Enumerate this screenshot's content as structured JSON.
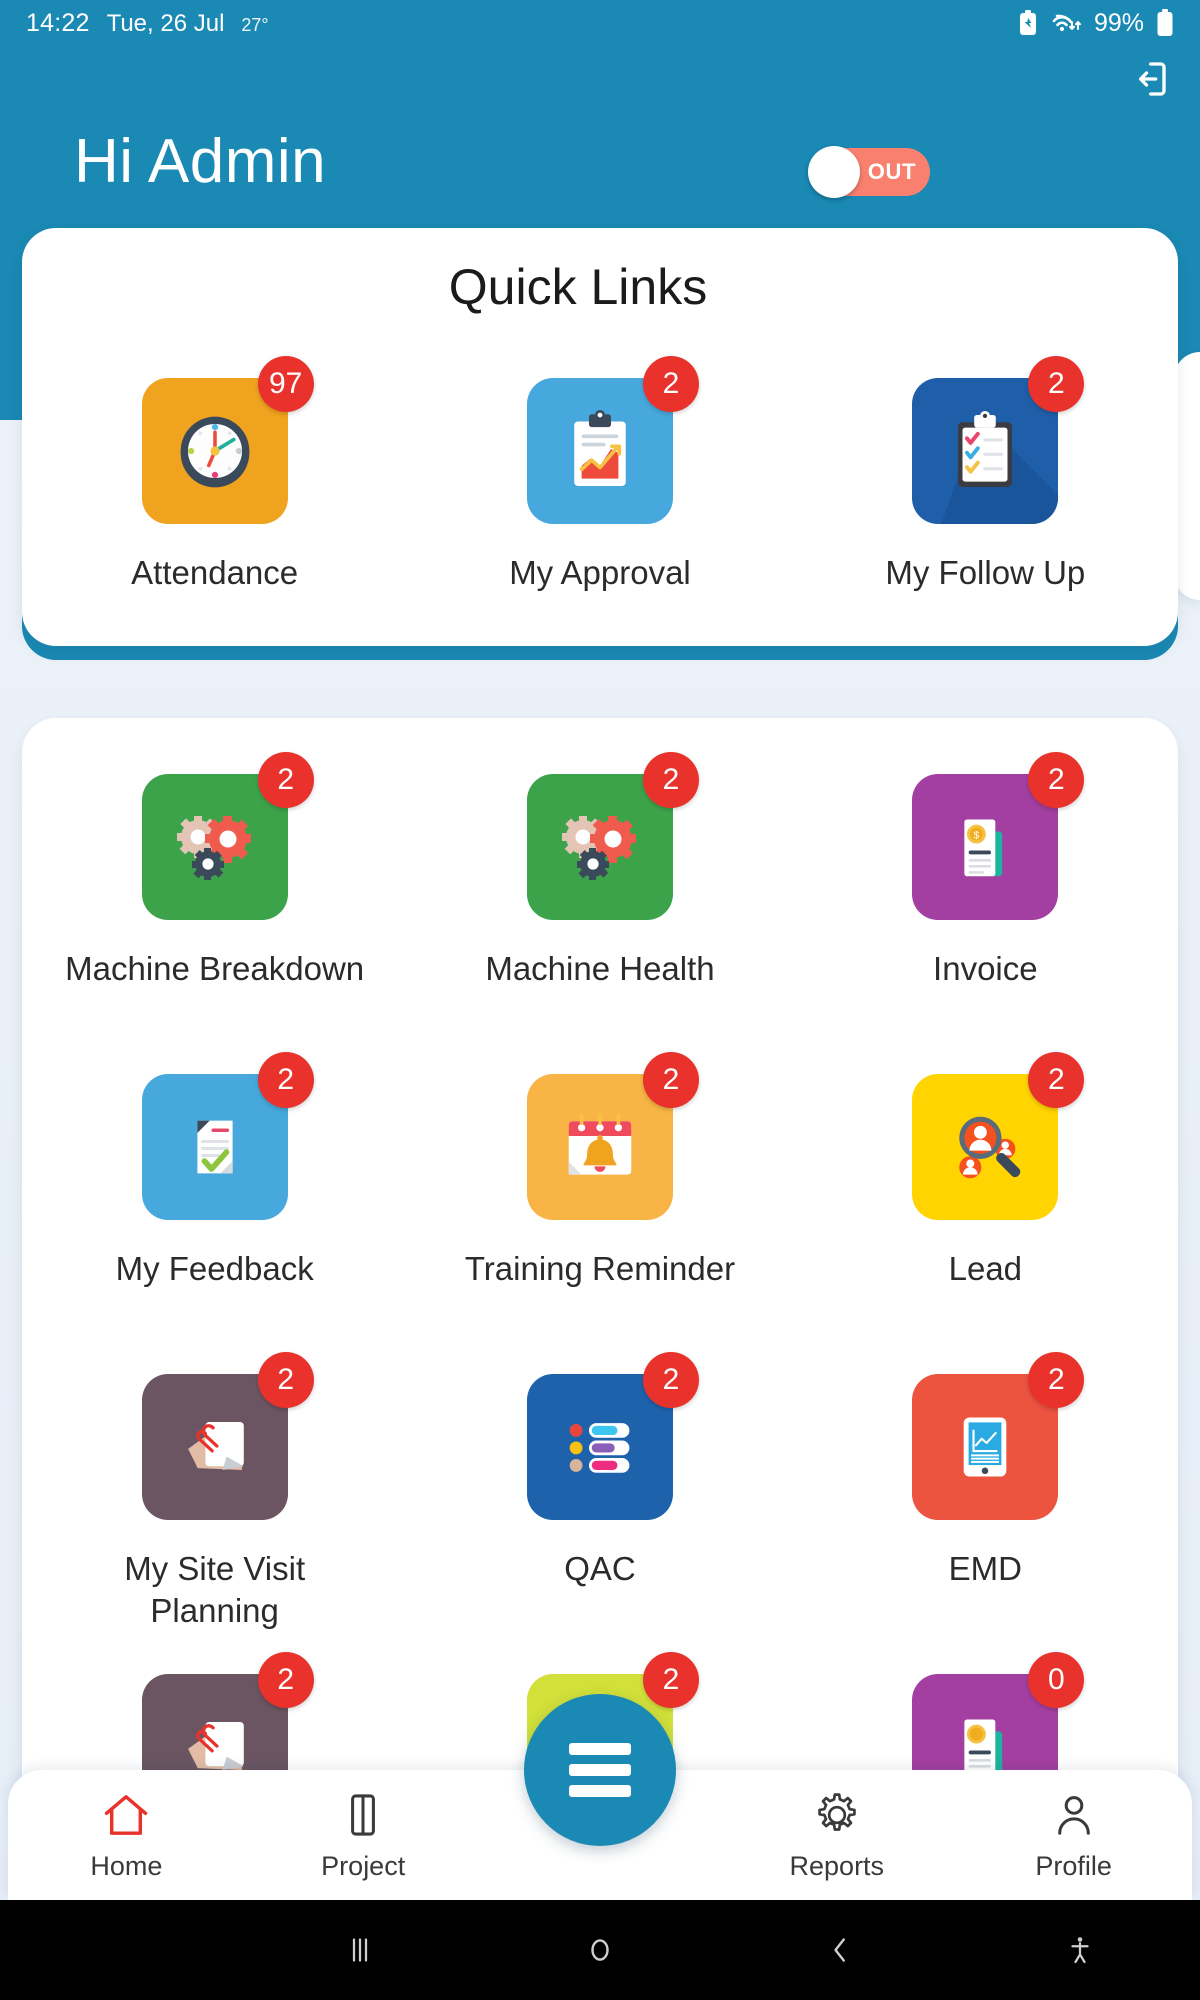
{
  "statusbar": {
    "time": "14:22",
    "date": "Tue, 26 Jul",
    "temperature": "27°",
    "battery_percent": "99%",
    "icons": [
      "battery-saver-icon",
      "wifi-transfer-icon",
      "battery-icon"
    ]
  },
  "header": {
    "greeting": "Hi Admin",
    "toggle_label": "OUT",
    "toggle_color": "#f9806e",
    "logout_icon": "logout-icon",
    "background_color": "#1a89b4"
  },
  "quick_links": {
    "title": "Quick Links",
    "items": [
      {
        "label": "Attendance",
        "badge": "97",
        "icon": "clock-icon",
        "color": "#f0a31e"
      },
      {
        "label": "My Approval",
        "badge": "2",
        "icon": "clipboard-chart-icon",
        "color": "#47a8dd"
      },
      {
        "label": "My Follow Up",
        "badge": "2",
        "icon": "clipboard-check-icon",
        "color": "#1f5fa9"
      }
    ]
  },
  "main_grid": {
    "items": [
      {
        "label": "Machine Breakdown",
        "badge": "2",
        "icon": "gears-icon",
        "color": "#3da34b"
      },
      {
        "label": "Machine Health",
        "badge": "2",
        "icon": "gears-icon",
        "color": "#3da34b"
      },
      {
        "label": "Invoice",
        "badge": "2",
        "icon": "invoice-coin-icon",
        "color": "#a33fa0"
      },
      {
        "label": "My Feedback",
        "badge": "2",
        "icon": "document-check-icon",
        "color": "#47a8dd"
      },
      {
        "label": "Training Reminder",
        "badge": "2",
        "icon": "calendar-bell-icon",
        "color": "#f8b545"
      },
      {
        "label": "Lead",
        "badge": "2",
        "icon": "search-people-icon",
        "color": "#ffd400"
      },
      {
        "label": "My Site Visit Planning",
        "badge": "2",
        "icon": "paper-clip-icon",
        "color": "#6b5562"
      },
      {
        "label": "QAC",
        "badge": "2",
        "icon": "checklist-bars-icon",
        "color": "#1f62ac"
      },
      {
        "label": "EMD",
        "badge": "2",
        "icon": "tablet-chart-icon",
        "color": "#ed5440"
      },
      {
        "label": "",
        "badge": "2",
        "icon": "paper-clip-icon",
        "color": "#6b5562"
      },
      {
        "label": "",
        "badge": "2",
        "icon": "lime-tile-icon",
        "color": "#d2e03a"
      },
      {
        "label": "",
        "badge": "0",
        "icon": "invoice-coin-icon",
        "color": "#a33fa0"
      }
    ]
  },
  "bottom_nav": {
    "items": [
      {
        "label": "Home",
        "icon": "home-icon",
        "active": true
      },
      {
        "label": "Project",
        "icon": "book-icon",
        "active": false
      },
      {
        "label": "Reports",
        "icon": "gear-icon",
        "active": false
      },
      {
        "label": "Profile",
        "icon": "person-icon",
        "active": false
      }
    ],
    "fab_icon": "menu-icon",
    "active_color": "#e8322b"
  },
  "android_nav": {
    "items": [
      "recents-icon",
      "home-circle-icon",
      "back-icon",
      "accessibility-icon"
    ]
  }
}
